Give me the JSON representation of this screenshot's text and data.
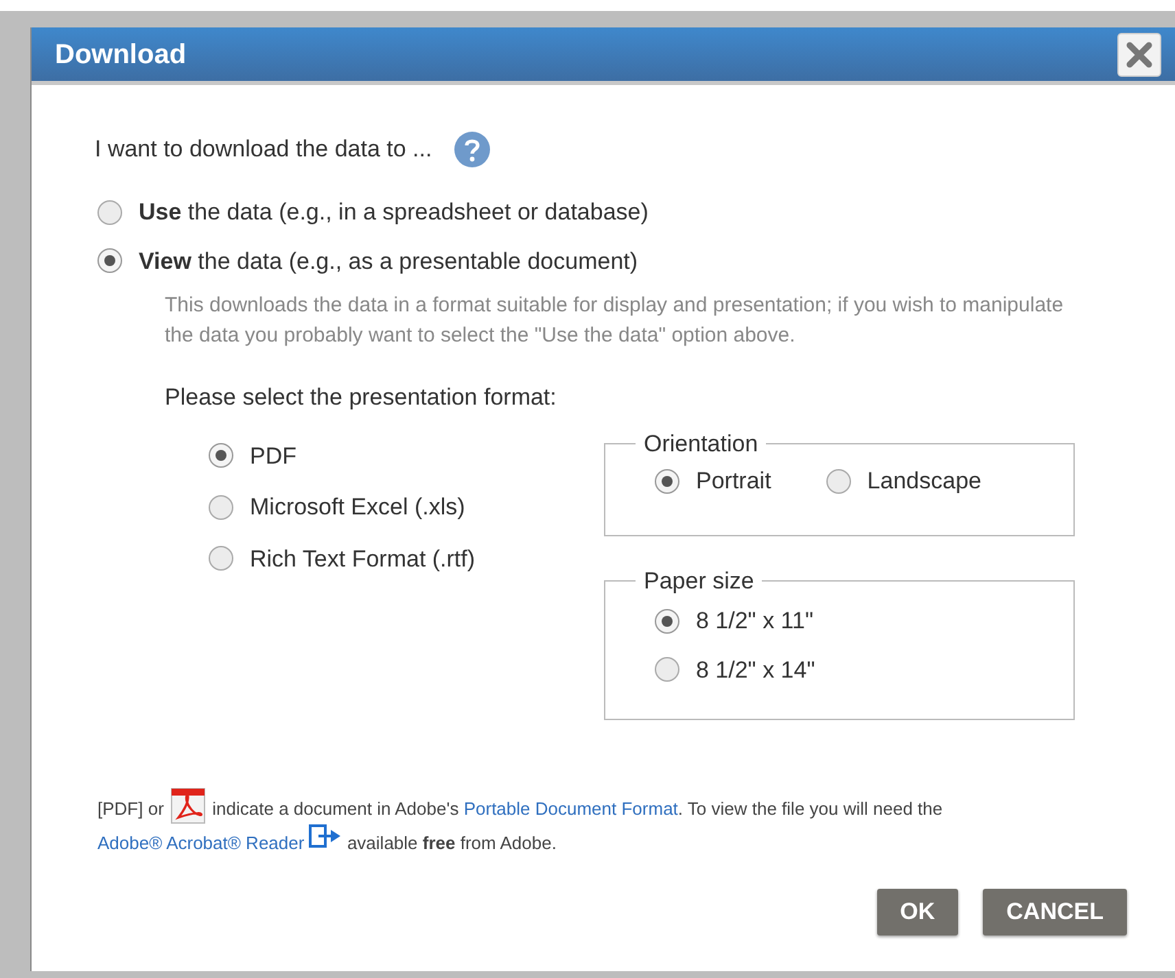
{
  "dialog": {
    "title": "Download"
  },
  "prompt": "I want to download the data to ...",
  "purpose_options": [
    {
      "label": "**Use** the data (e.g., in a spreadsheet or database)",
      "selected": false
    },
    {
      "label": "**View** the data (e.g., as a presentable document)",
      "selected": true
    }
  ],
  "description": "This downloads the data in a format suitable for display and presentation; if you wish to manipulate the data you probably want to select the \"Use the data\" option above.",
  "format_heading": "Please select the presentation format:",
  "formats": [
    {
      "label": "PDF",
      "selected": true
    },
    {
      "label": "Microsoft Excel (.xls)",
      "selected": false
    },
    {
      "label": "Rich Text Format (.rtf)",
      "selected": false
    }
  ],
  "orientation": {
    "legend": "Orientation",
    "options": [
      {
        "label": "Portrait",
        "selected": true
      },
      {
        "label": "Landscape",
        "selected": false
      }
    ]
  },
  "paper_size": {
    "legend": "Paper size",
    "options": [
      {
        "label": "8 1/2\" x 11\"",
        "selected": true
      },
      {
        "label": "8 1/2\" x 14\"",
        "selected": false
      }
    ]
  },
  "footer": [
    {
      "kind": "text",
      "text": "[PDF] or"
    },
    {
      "kind": "pdf-icon"
    },
    {
      "kind": "text",
      "text": "indicate a document in Adobe's"
    },
    {
      "kind": "link",
      "text": "Portable Document Format"
    },
    {
      "kind": "text",
      "text": ". To view the file you will need the",
      "attached": true
    },
    {
      "kind": "link",
      "text": "Adobe® Acrobat® Reader"
    },
    {
      "kind": "external-icon"
    },
    {
      "kind": "text",
      "text": "available **free** from Adobe."
    }
  ],
  "buttons": [
    "OK",
    "CANCEL"
  ]
}
